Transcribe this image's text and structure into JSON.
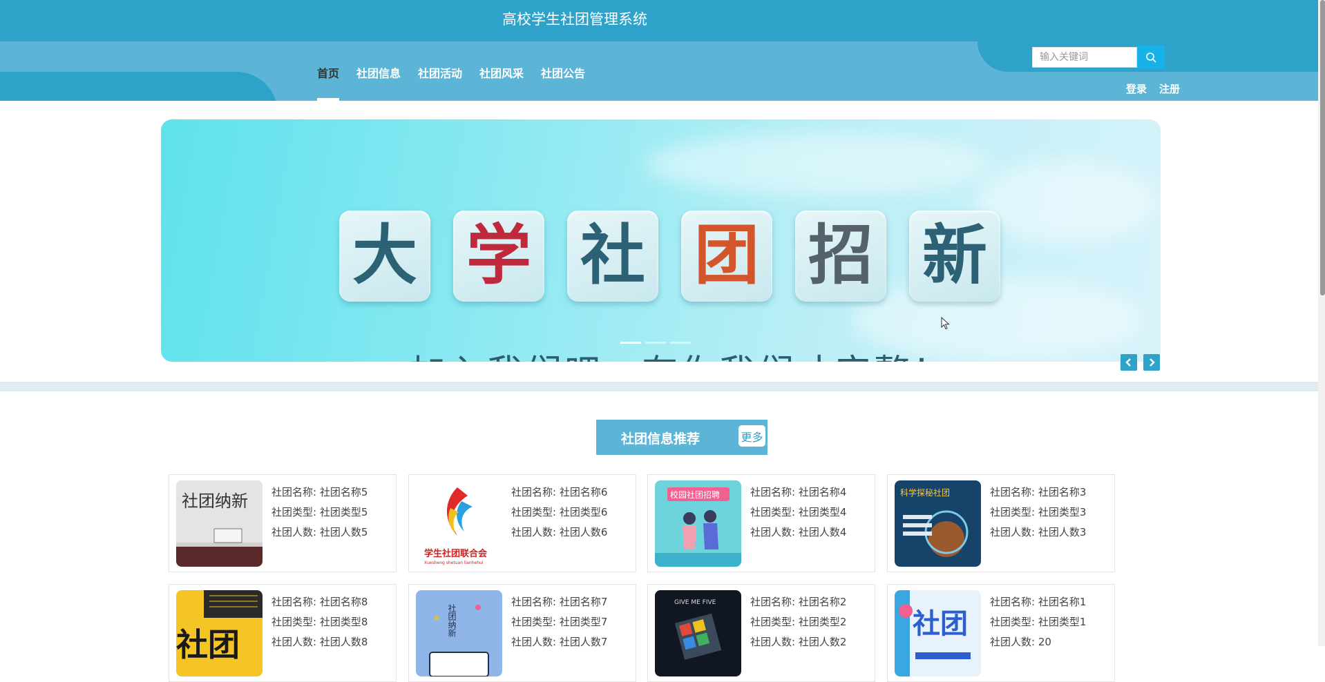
{
  "header": {
    "title": "高校学生社团管理系统",
    "nav": [
      {
        "label": "首页"
      },
      {
        "label": "社团信息"
      },
      {
        "label": "社团活动"
      },
      {
        "label": "社团风采"
      },
      {
        "label": "社团公告"
      }
    ],
    "search": {
      "placeholder": "输入关键词",
      "icon": "search-icon"
    },
    "login": "登录",
    "register": "注册"
  },
  "banner": {
    "characters": [
      "大",
      "学",
      "社",
      "团",
      "招",
      "新"
    ],
    "character_colors": [
      "#2d6175",
      "#c0283c",
      "#2d6175",
      "#d2552b",
      "#55626b",
      "#2d6175"
    ],
    "slogan": "加入我们吧，有你我们才完整！",
    "slide_count": 3,
    "active_slide": 1,
    "prev_icon": "chevron-left-icon",
    "next_icon": "chevron-right-icon"
  },
  "section": {
    "title": "社团信息推荐",
    "more": "更多"
  },
  "clubs": [
    {
      "name_label": "社团名称: 社团名称5",
      "type_label": "社团类型: 社团类型5",
      "count_label": "社团人数: 社团人数5"
    },
    {
      "name_label": "社团名称: 社团名称6",
      "type_label": "社团类型: 社团类型6",
      "count_label": "社团人数: 社团人数6"
    },
    {
      "name_label": "社团名称: 社团名称4",
      "type_label": "社团类型: 社团类型4",
      "count_label": "社团人数: 社团人数4"
    },
    {
      "name_label": "社团名称: 社团名称3",
      "type_label": "社团类型: 社团类型3",
      "count_label": "社团人数: 社团人数3"
    },
    {
      "name_label": "社团名称: 社团名称8",
      "type_label": "社团类型: 社团类型8",
      "count_label": "社团人数: 社团人数8"
    },
    {
      "name_label": "社团名称: 社团名称7",
      "type_label": "社团类型: 社团类型7",
      "count_label": "社团人数: 社团人数7"
    },
    {
      "name_label": "社团名称: 社团名称2",
      "type_label": "社团类型: 社团类型2",
      "count_label": "社团人数: 社团人数2"
    },
    {
      "name_label": "社团名称: 社团名称1",
      "type_label": "社团类型: 社团类型1",
      "count_label": "社团人数: 20"
    }
  ],
  "club_images": [
    {
      "caption": "社团纳新"
    },
    {
      "caption": "学生社团联合会",
      "subcaption": "Xuesheng shetuan lianhehui"
    },
    {
      "caption": "校园社团招聘"
    },
    {
      "caption": "科学探秘社团"
    },
    {
      "caption": "社团"
    },
    {
      "caption": "社团纳新"
    },
    {
      "caption": "GIVE ME FIVE"
    },
    {
      "caption": "社团"
    }
  ],
  "colors": {
    "header_dark": "#2ea2c9",
    "header_light": "#5cb5d6",
    "search_button": "#18b2ea"
  }
}
